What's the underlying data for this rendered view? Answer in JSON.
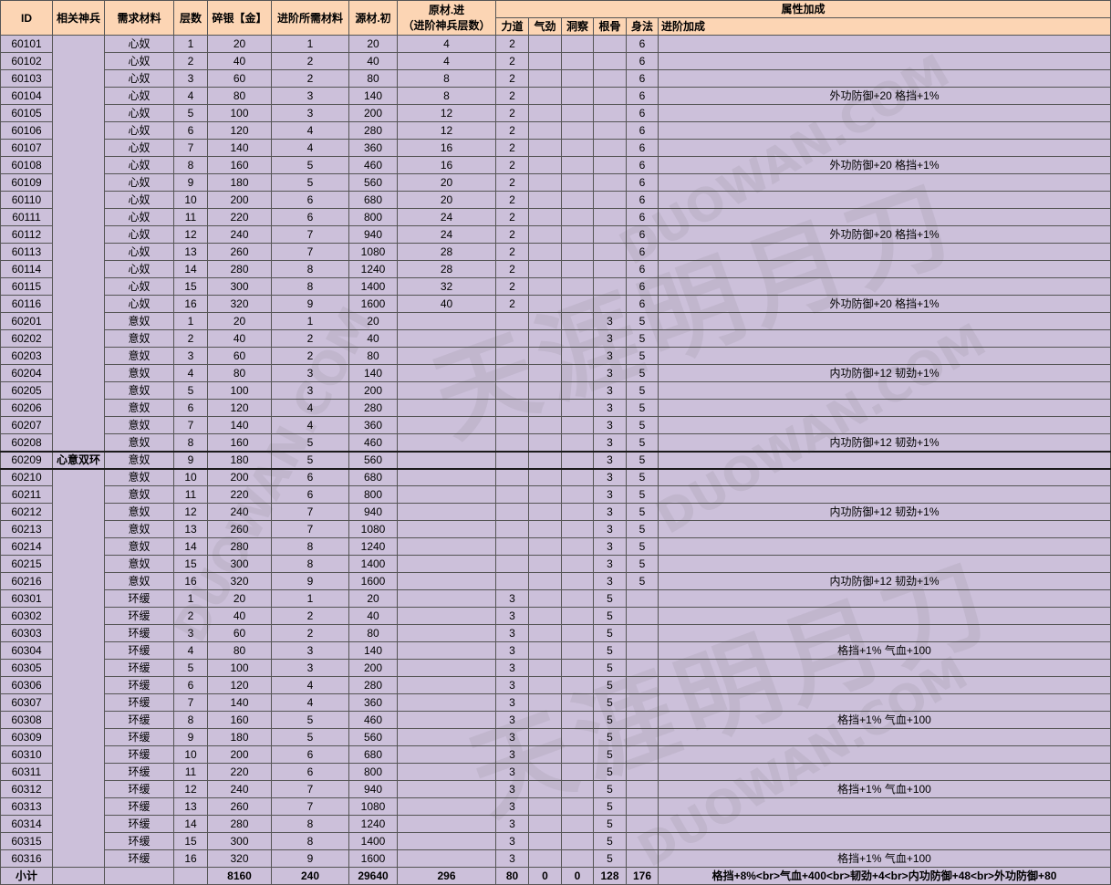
{
  "colors": {
    "header_bg": "#FCD5B4",
    "body_bg": "#CCC0DA",
    "grid": "#555555"
  },
  "watermark": {
    "logo_text": "天涯明月刀",
    "site": "DUOWAN.COM"
  },
  "table": {
    "headers": {
      "id": "ID",
      "weapon": "相关神兵",
      "mat": "需求材料",
      "lvl": "层数",
      "silver": "碎银【金】",
      "adv": "进阶所需材料",
      "src": "源材.初",
      "src_adv_title": "原材.进",
      "src_adv_note": "（进阶神兵层数）",
      "attr_group": "属性加成",
      "str": "力道",
      "qi": "气劲",
      "ins": "洞察",
      "bone": "根骨",
      "agi": "身法",
      "bonus": "进阶加成"
    },
    "rows": [
      {
        "id": "60101",
        "mat": "心奴",
        "lvl": 1,
        "silver": 20,
        "adv": 1,
        "src": 20,
        "src_adv": 4,
        "str": 2,
        "agi": 6
      },
      {
        "id": "60102",
        "mat": "心奴",
        "lvl": 2,
        "silver": 40,
        "adv": 2,
        "src": 40,
        "src_adv": 4,
        "str": 2,
        "agi": 6
      },
      {
        "id": "60103",
        "mat": "心奴",
        "lvl": 3,
        "silver": 60,
        "adv": 2,
        "src": 80,
        "src_adv": 8,
        "str": 2,
        "agi": 6
      },
      {
        "id": "60104",
        "mat": "心奴",
        "lvl": 4,
        "silver": 80,
        "adv": 3,
        "src": 140,
        "src_adv": 8,
        "str": 2,
        "agi": 6,
        "bonus": "外功防御+20    格挡+1%"
      },
      {
        "id": "60105",
        "mat": "心奴",
        "lvl": 5,
        "silver": 100,
        "adv": 3,
        "src": 200,
        "src_adv": 12,
        "str": 2,
        "agi": 6
      },
      {
        "id": "60106",
        "mat": "心奴",
        "lvl": 6,
        "silver": 120,
        "adv": 4,
        "src": 280,
        "src_adv": 12,
        "str": 2,
        "agi": 6
      },
      {
        "id": "60107",
        "mat": "心奴",
        "lvl": 7,
        "silver": 140,
        "adv": 4,
        "src": 360,
        "src_adv": 16,
        "str": 2,
        "agi": 6
      },
      {
        "id": "60108",
        "mat": "心奴",
        "lvl": 8,
        "silver": 160,
        "adv": 5,
        "src": 460,
        "src_adv": 16,
        "str": 2,
        "agi": 6,
        "bonus": "外功防御+20    格挡+1%"
      },
      {
        "id": "60109",
        "mat": "心奴",
        "lvl": 9,
        "silver": 180,
        "adv": 5,
        "src": 560,
        "src_adv": 20,
        "str": 2,
        "agi": 6
      },
      {
        "id": "60110",
        "mat": "心奴",
        "lvl": 10,
        "silver": 200,
        "adv": 6,
        "src": 680,
        "src_adv": 20,
        "str": 2,
        "agi": 6
      },
      {
        "id": "60111",
        "mat": "心奴",
        "lvl": 11,
        "silver": 220,
        "adv": 6,
        "src": 800,
        "src_adv": 24,
        "str": 2,
        "agi": 6
      },
      {
        "id": "60112",
        "mat": "心奴",
        "lvl": 12,
        "silver": 240,
        "adv": 7,
        "src": 940,
        "src_adv": 24,
        "str": 2,
        "agi": 6,
        "bonus": "外功防御+20    格挡+1%"
      },
      {
        "id": "60113",
        "mat": "心奴",
        "lvl": 13,
        "silver": 260,
        "adv": 7,
        "src": 1080,
        "src_adv": 28,
        "str": 2,
        "agi": 6
      },
      {
        "id": "60114",
        "mat": "心奴",
        "lvl": 14,
        "silver": 280,
        "adv": 8,
        "src": 1240,
        "src_adv": 28,
        "str": 2,
        "agi": 6
      },
      {
        "id": "60115",
        "mat": "心奴",
        "lvl": 15,
        "silver": 300,
        "adv": 8,
        "src": 1400,
        "src_adv": 32,
        "str": 2,
        "agi": 6
      },
      {
        "id": "60116",
        "mat": "心奴",
        "lvl": 16,
        "silver": 320,
        "adv": 9,
        "src": 1600,
        "src_adv": 40,
        "str": 2,
        "agi": 6,
        "bonus": "外功防御+20    格挡+1%"
      },
      {
        "id": "60201",
        "mat": "意奴",
        "lvl": 1,
        "silver": 20,
        "adv": 1,
        "src": 20,
        "bone": 3,
        "agi": 5
      },
      {
        "id": "60202",
        "mat": "意奴",
        "lvl": 2,
        "silver": 40,
        "adv": 2,
        "src": 40,
        "bone": 3,
        "agi": 5
      },
      {
        "id": "60203",
        "mat": "意奴",
        "lvl": 3,
        "silver": 60,
        "adv": 2,
        "src": 80,
        "bone": 3,
        "agi": 5
      },
      {
        "id": "60204",
        "mat": "意奴",
        "lvl": 4,
        "silver": 80,
        "adv": 3,
        "src": 140,
        "bone": 3,
        "agi": 5,
        "bonus": "内功防御+12    韧劲+1%"
      },
      {
        "id": "60205",
        "mat": "意奴",
        "lvl": 5,
        "silver": 100,
        "adv": 3,
        "src": 200,
        "bone": 3,
        "agi": 5
      },
      {
        "id": "60206",
        "mat": "意奴",
        "lvl": 6,
        "silver": 120,
        "adv": 4,
        "src": 280,
        "bone": 3,
        "agi": 5
      },
      {
        "id": "60207",
        "mat": "意奴",
        "lvl": 7,
        "silver": 140,
        "adv": 4,
        "src": 360,
        "bone": 3,
        "agi": 5
      },
      {
        "id": "60208",
        "mat": "意奴",
        "lvl": 8,
        "silver": 160,
        "adv": 5,
        "src": 460,
        "bone": 3,
        "agi": 5,
        "bonus": "内功防御+12    韧劲+1%"
      },
      {
        "id": "60209",
        "weapon": "心意双环",
        "mat": "意奴",
        "lvl": 9,
        "silver": 180,
        "adv": 5,
        "src": 560,
        "bone": 3,
        "agi": 5
      },
      {
        "id": "60210",
        "mat": "意奴",
        "lvl": 10,
        "silver": 200,
        "adv": 6,
        "src": 680,
        "bone": 3,
        "agi": 5
      },
      {
        "id": "60211",
        "mat": "意奴",
        "lvl": 11,
        "silver": 220,
        "adv": 6,
        "src": 800,
        "bone": 3,
        "agi": 5
      },
      {
        "id": "60212",
        "mat": "意奴",
        "lvl": 12,
        "silver": 240,
        "adv": 7,
        "src": 940,
        "bone": 3,
        "agi": 5,
        "bonus": "内功防御+12    韧劲+1%"
      },
      {
        "id": "60213",
        "mat": "意奴",
        "lvl": 13,
        "silver": 260,
        "adv": 7,
        "src": 1080,
        "bone": 3,
        "agi": 5
      },
      {
        "id": "60214",
        "mat": "意奴",
        "lvl": 14,
        "silver": 280,
        "adv": 8,
        "src": 1240,
        "bone": 3,
        "agi": 5
      },
      {
        "id": "60215",
        "mat": "意奴",
        "lvl": 15,
        "silver": 300,
        "adv": 8,
        "src": 1400,
        "bone": 3,
        "agi": 5
      },
      {
        "id": "60216",
        "mat": "意奴",
        "lvl": 16,
        "silver": 320,
        "adv": 9,
        "src": 1600,
        "bone": 3,
        "agi": 5,
        "bonus": "内功防御+12    韧劲+1%"
      },
      {
        "id": "60301",
        "mat": "环缓",
        "lvl": 1,
        "silver": 20,
        "adv": 1,
        "src": 20,
        "str": 3,
        "bone": 5
      },
      {
        "id": "60302",
        "mat": "环缓",
        "lvl": 2,
        "silver": 40,
        "adv": 2,
        "src": 40,
        "str": 3,
        "bone": 5
      },
      {
        "id": "60303",
        "mat": "环缓",
        "lvl": 3,
        "silver": 60,
        "adv": 2,
        "src": 80,
        "str": 3,
        "bone": 5
      },
      {
        "id": "60304",
        "mat": "环缓",
        "lvl": 4,
        "silver": 80,
        "adv": 3,
        "src": 140,
        "str": 3,
        "bone": 5,
        "bonus": "格挡+1%    气血+100"
      },
      {
        "id": "60305",
        "mat": "环缓",
        "lvl": 5,
        "silver": 100,
        "adv": 3,
        "src": 200,
        "str": 3,
        "bone": 5
      },
      {
        "id": "60306",
        "mat": "环缓",
        "lvl": 6,
        "silver": 120,
        "adv": 4,
        "src": 280,
        "str": 3,
        "bone": 5
      },
      {
        "id": "60307",
        "mat": "环缓",
        "lvl": 7,
        "silver": 140,
        "adv": 4,
        "src": 360,
        "str": 3,
        "bone": 5
      },
      {
        "id": "60308",
        "mat": "环缓",
        "lvl": 8,
        "silver": 160,
        "adv": 5,
        "src": 460,
        "str": 3,
        "bone": 5,
        "bonus": "格挡+1%    气血+100"
      },
      {
        "id": "60309",
        "mat": "环缓",
        "lvl": 9,
        "silver": 180,
        "adv": 5,
        "src": 560,
        "str": 3,
        "bone": 5
      },
      {
        "id": "60310",
        "mat": "环缓",
        "lvl": 10,
        "silver": 200,
        "adv": 6,
        "src": 680,
        "str": 3,
        "bone": 5
      },
      {
        "id": "60311",
        "mat": "环缓",
        "lvl": 11,
        "silver": 220,
        "adv": 6,
        "src": 800,
        "str": 3,
        "bone": 5
      },
      {
        "id": "60312",
        "mat": "环缓",
        "lvl": 12,
        "silver": 240,
        "adv": 7,
        "src": 940,
        "str": 3,
        "bone": 5,
        "bonus": "格挡+1%    气血+100"
      },
      {
        "id": "60313",
        "mat": "环缓",
        "lvl": 13,
        "silver": 260,
        "adv": 7,
        "src": 1080,
        "str": 3,
        "bone": 5
      },
      {
        "id": "60314",
        "mat": "环缓",
        "lvl": 14,
        "silver": 280,
        "adv": 8,
        "src": 1240,
        "str": 3,
        "bone": 5
      },
      {
        "id": "60315",
        "mat": "环缓",
        "lvl": 15,
        "silver": 300,
        "adv": 8,
        "src": 1400,
        "str": 3,
        "bone": 5
      },
      {
        "id": "60316",
        "mat": "环缓",
        "lvl": 16,
        "silver": 320,
        "adv": 9,
        "src": 1600,
        "str": 3,
        "bone": 5,
        "bonus": "格挡+1%    气血+100"
      }
    ],
    "subtotal": {
      "label": "小计",
      "silver": 8160,
      "adv": 240,
      "src": 29640,
      "src_adv": 296,
      "str": 80,
      "qi": 0,
      "ins": 0,
      "bone": 128,
      "agi": 176,
      "bonus": "格挡+8%<br>气血+400<br>韧劲+4<br>内功防御+48<br>外功防御+80"
    }
  }
}
